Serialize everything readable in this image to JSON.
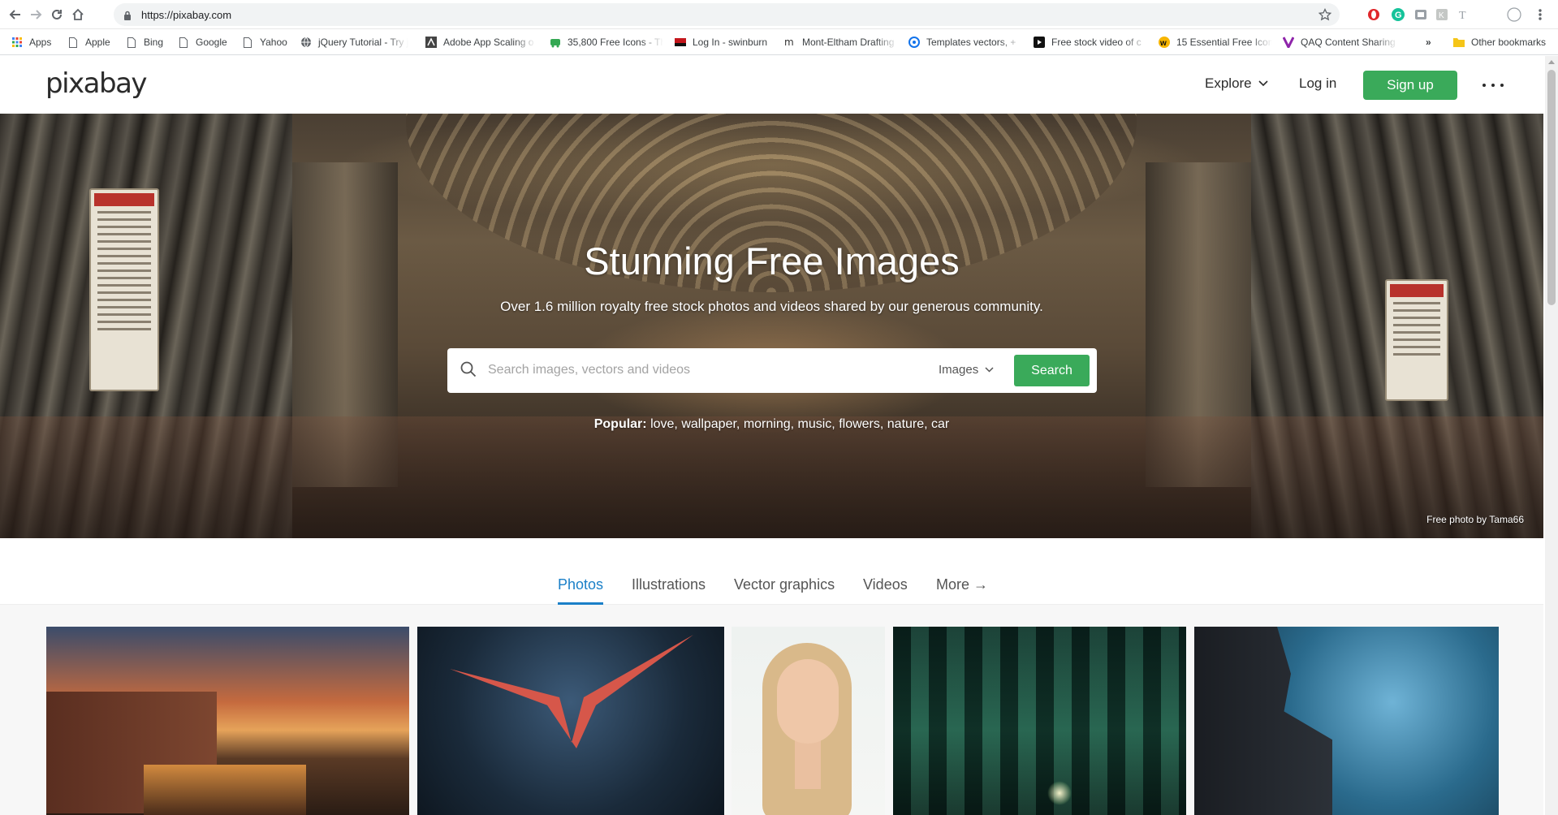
{
  "browser": {
    "url": "https://pixabay.com",
    "bookmarks": [
      {
        "label": "Apps",
        "icon": "apps-grid-icon"
      },
      {
        "label": "Apple",
        "icon": "page-icon"
      },
      {
        "label": "Bing",
        "icon": "page-icon"
      },
      {
        "label": "Google",
        "icon": "page-icon"
      },
      {
        "label": "Yahoo",
        "icon": "page-icon"
      },
      {
        "label": "jQuery Tutorial - Try j",
        "icon": "globe-icon"
      },
      {
        "label": "Adobe App Scaling o",
        "icon": "adobe-icon"
      },
      {
        "label": "35,800 Free Icons - Th",
        "icon": "icons-site-icon"
      },
      {
        "label": "Log In - swinburn",
        "icon": "swinburne-icon"
      },
      {
        "label": "Mont-Eltham Drafting",
        "icon": "m-letter-icon"
      },
      {
        "label": "Templates vectors, +",
        "icon": "freepik-icon"
      },
      {
        "label": "Free stock video of c",
        "icon": "play-icon"
      },
      {
        "label": "15 Essential Free Icon",
        "icon": "w-badge-icon"
      },
      {
        "label": "QAQ Content Sharing",
        "icon": "v-logo-icon"
      }
    ],
    "bookmarks_overflow": "»",
    "other_bookmarks": "Other bookmarks"
  },
  "header": {
    "logo": "pixabay",
    "explore": "Explore",
    "login": "Log in",
    "signup": "Sign up"
  },
  "hero": {
    "title": "Stunning Free Images",
    "subtitle": "Over 1.6 million royalty free stock photos and videos shared by our generous community.",
    "search_placeholder": "Search images, vectors and videos",
    "search_type": "Images",
    "search_button": "Search",
    "popular_label": "Popular:",
    "popular_terms": [
      "love",
      "wallpaper",
      "morning",
      "music",
      "flowers",
      "nature",
      "car"
    ],
    "credit": "Free photo by Tama66"
  },
  "tabs": {
    "items": [
      "Photos",
      "Illustrations",
      "Vector graphics",
      "Videos",
      "More →"
    ],
    "active": "Photos"
  },
  "colors": {
    "brand_green": "#3aaa5a",
    "active_tab_blue": "#1b80c8"
  }
}
